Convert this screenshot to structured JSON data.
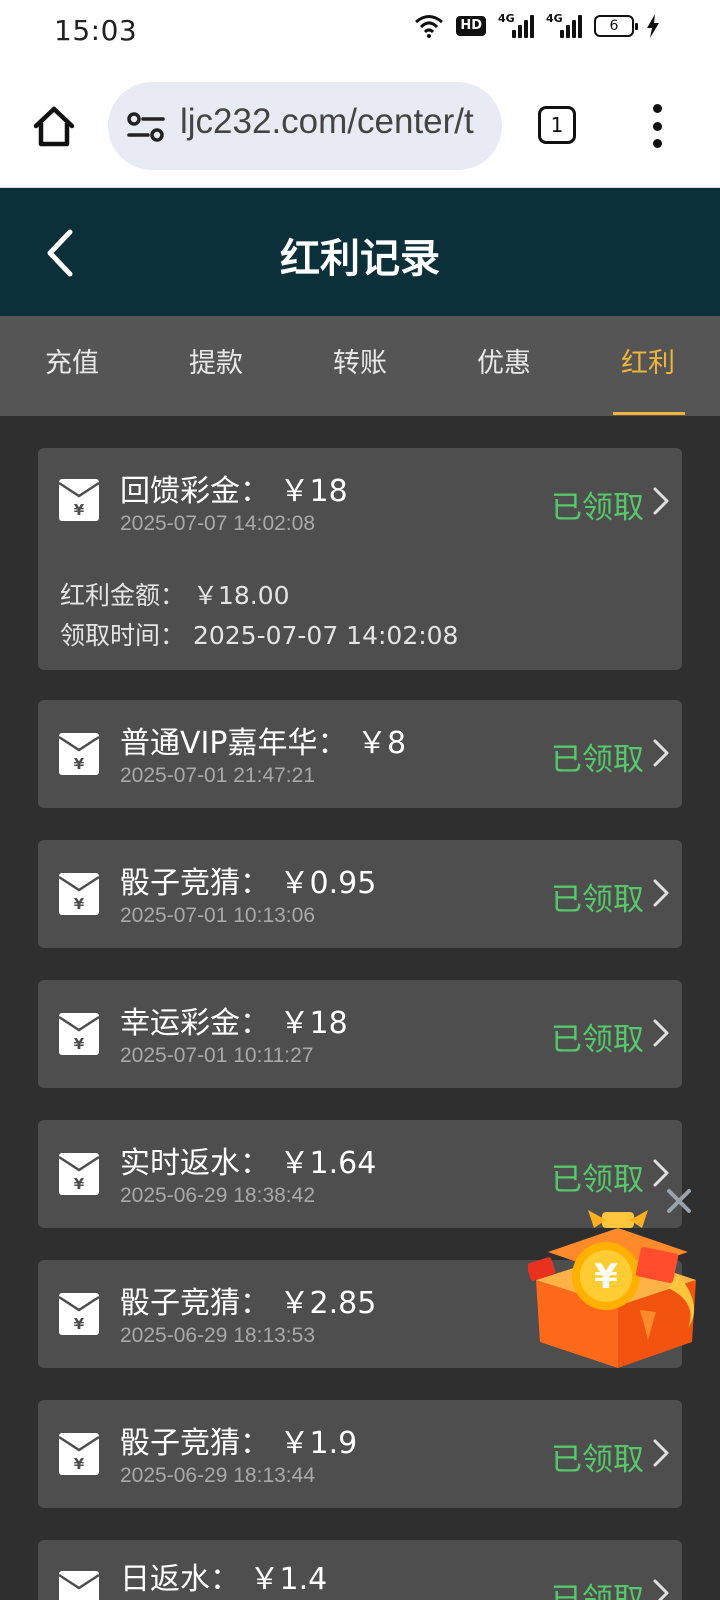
{
  "status_bar": {
    "time": "15:03",
    "hd_label": "HD",
    "network_label": "4G",
    "battery_level": "6"
  },
  "browser": {
    "url": "ljc232.com/center/t",
    "tab_count": "1"
  },
  "header": {
    "title": "红利记录"
  },
  "tabs": [
    {
      "label": "充值"
    },
    {
      "label": "提款"
    },
    {
      "label": "转账"
    },
    {
      "label": "优惠"
    },
    {
      "label": "红利"
    }
  ],
  "active_tab": "红利",
  "colors": {
    "header_bg": "#0b3039",
    "accent": "#f0b43a",
    "status_green": "#56c86a",
    "card_bg": "#4e4e4e"
  },
  "records": [
    {
      "title": "回馈彩金： ￥18",
      "time": "2025-07-07 14:02:08",
      "status": "已领取",
      "expanded": true,
      "detail_amount": "红利金额： ￥18.00",
      "detail_time": "领取时间： 2025-07-07 14:02:08"
    },
    {
      "title": "普通VIP嘉年华： ￥8",
      "time": "2025-07-01 21:47:21",
      "status": "已领取"
    },
    {
      "title": "骰子竞猜： ￥0.95",
      "time": "2025-07-01 10:13:06",
      "status": "已领取"
    },
    {
      "title": "幸运彩金： ￥18",
      "time": "2025-07-01 10:11:27",
      "status": "已领取"
    },
    {
      "title": "实时返水： ￥1.64",
      "time": "2025-06-29 18:38:42",
      "status": "已领取"
    },
    {
      "title": "骰子竞猜： ￥2.85",
      "time": "2025-06-29 18:13:53",
      "status": ""
    },
    {
      "title": "骰子竞猜： ￥1.9",
      "time": "2025-06-29 18:13:44",
      "status": "已领取"
    },
    {
      "title": "日返水： ￥1.4",
      "time": "",
      "status": "已领取"
    }
  ],
  "promo": {
    "icon": "gift-box-icon"
  }
}
